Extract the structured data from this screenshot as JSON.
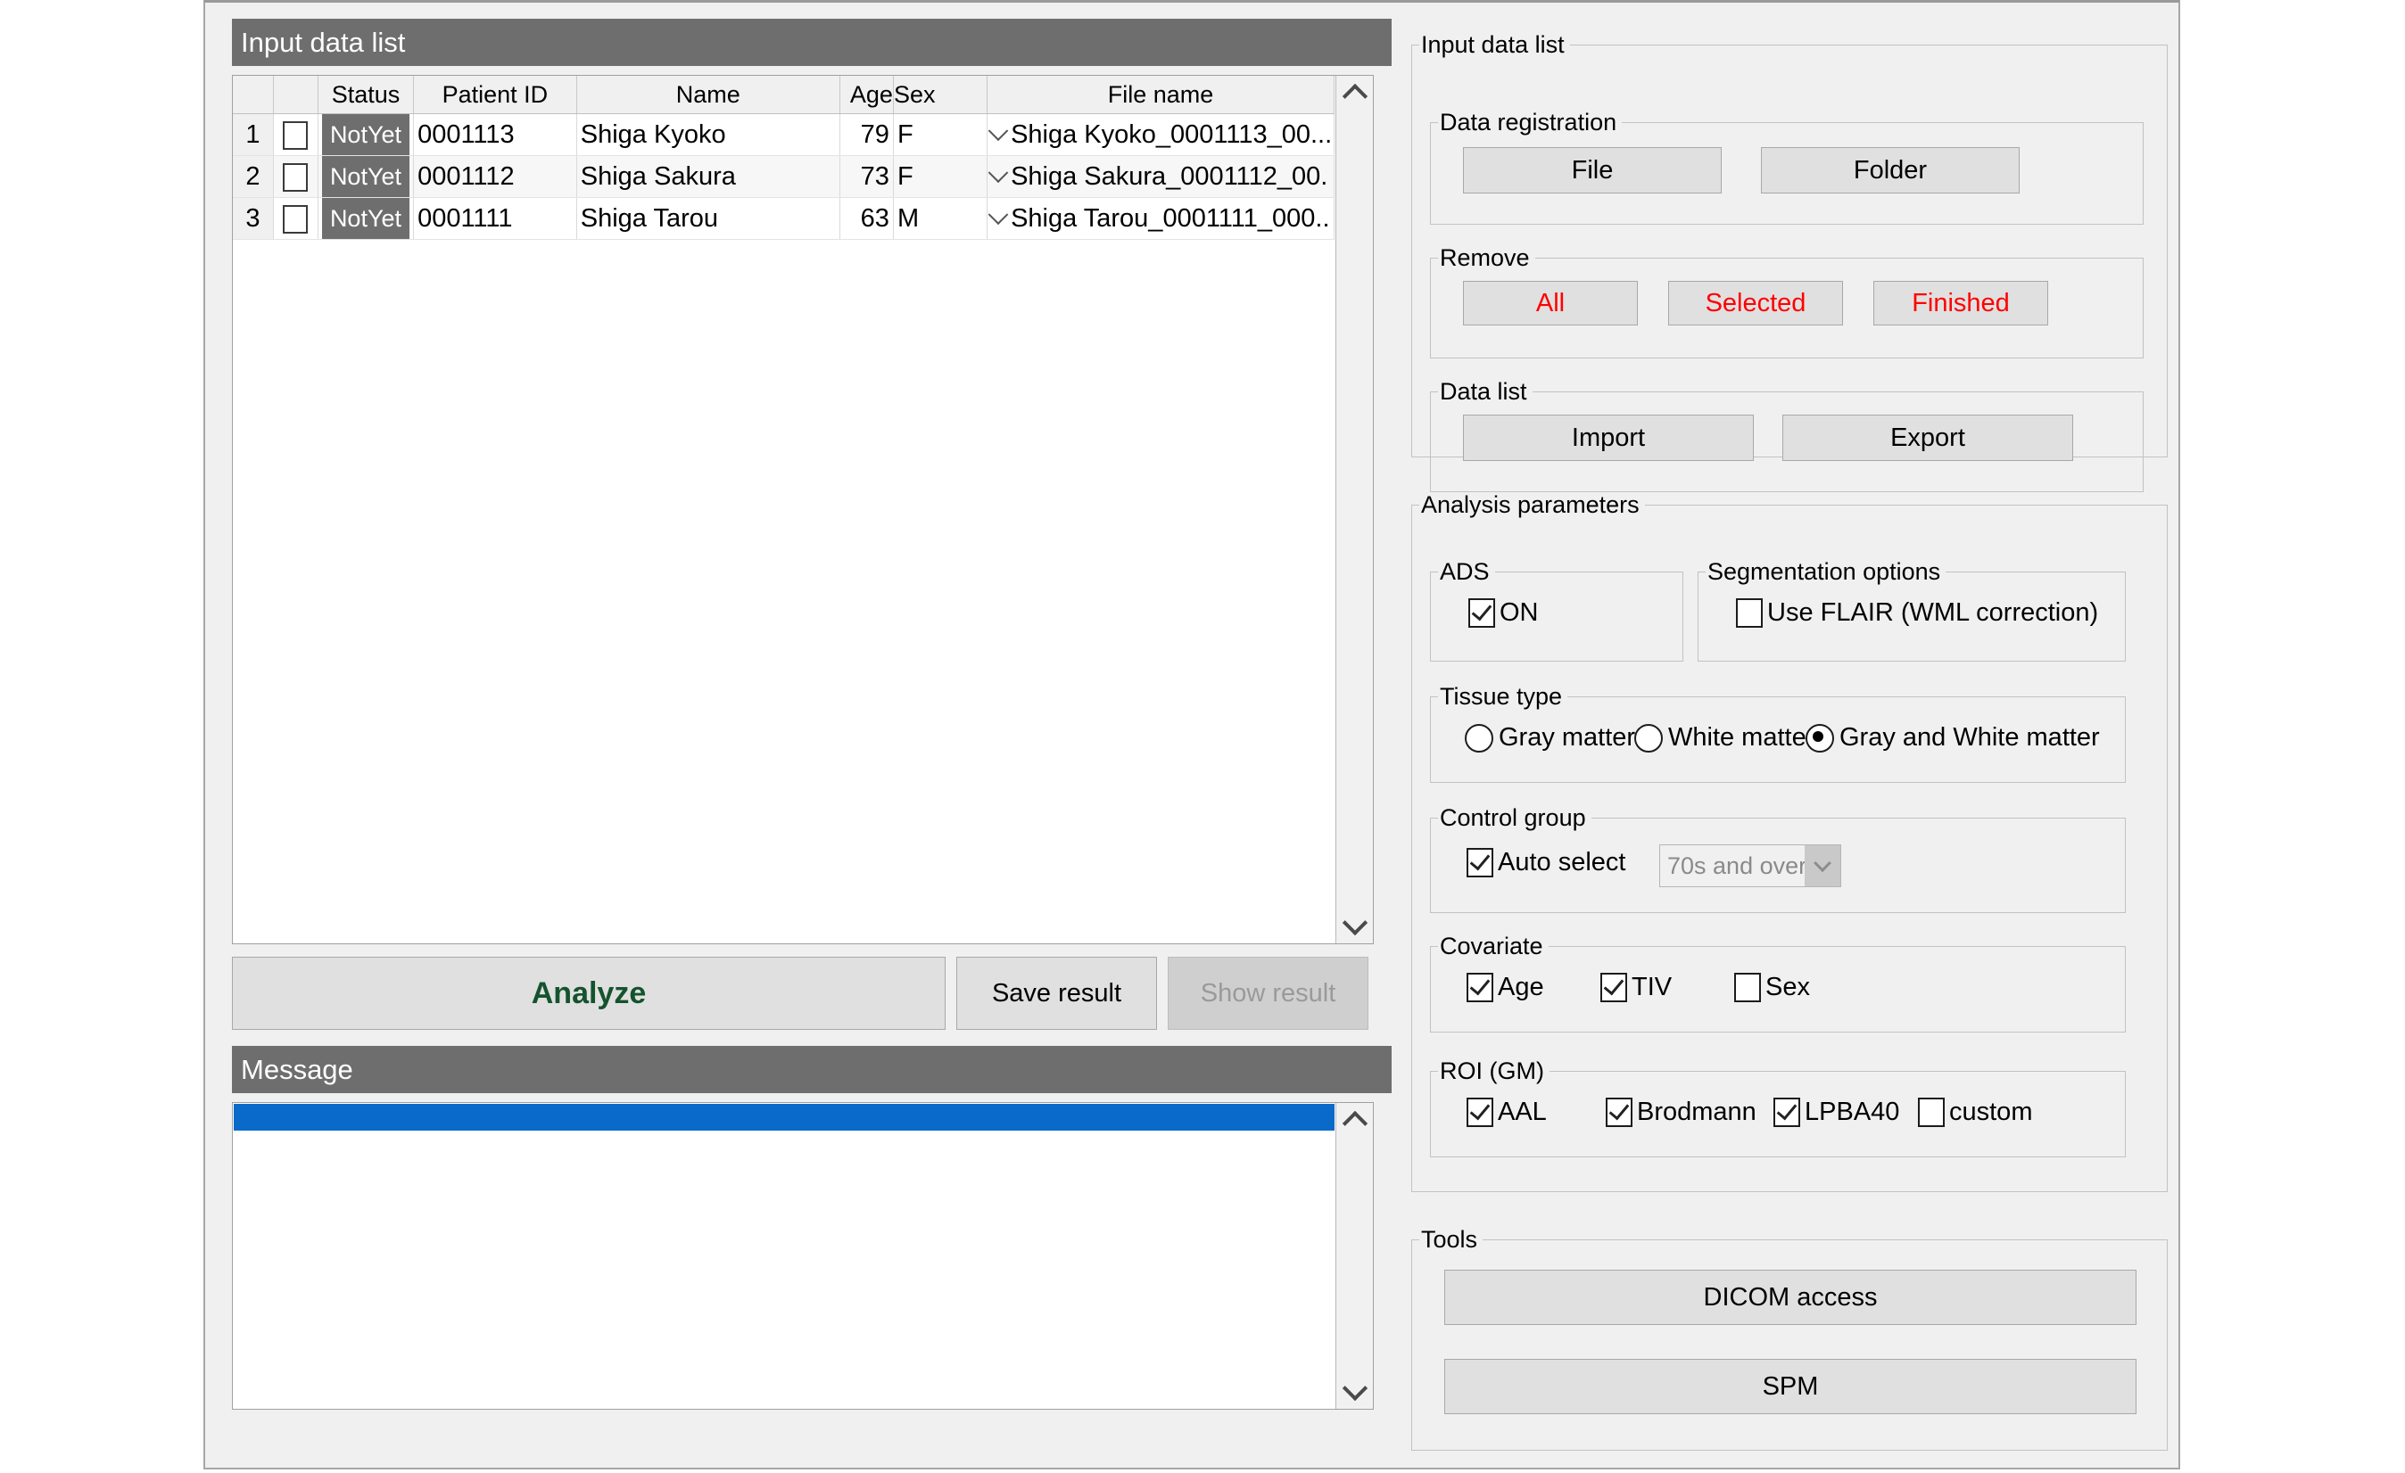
{
  "window": {
    "title": ""
  },
  "left": {
    "input_list_header": "Input data list",
    "table": {
      "columns": [
        "",
        "",
        "Status",
        "Patient ID",
        "Name",
        "Age",
        "Sex",
        "File name"
      ],
      "rows": [
        {
          "index": "1",
          "checked": false,
          "status": "NotYet",
          "patient_id": "0001113",
          "name": "Shiga Kyoko",
          "age": "79",
          "sex": "F",
          "file_name": "Shiga Kyoko_0001113_00..."
        },
        {
          "index": "2",
          "checked": false,
          "status": "NotYet",
          "patient_id": "0001112",
          "name": "Shiga Sakura",
          "age": "73",
          "sex": "F",
          "file_name": "Shiga Sakura_0001112_00..."
        },
        {
          "index": "3",
          "checked": false,
          "status": "NotYet",
          "patient_id": "0001111",
          "name": "Shiga Tarou",
          "age": "63",
          "sex": "M",
          "file_name": "Shiga Tarou_0001111_000..."
        }
      ]
    },
    "actions": {
      "analyze": "Analyze",
      "save_result": "Save result",
      "show_result": "Show result"
    },
    "message_header": "Message",
    "message_lines": []
  },
  "right": {
    "input_data_list": {
      "legend": "Input data list",
      "data_registration": {
        "legend": "Data registration",
        "file": "File",
        "folder": "Folder"
      },
      "remove": {
        "legend": "Remove",
        "all": "All",
        "selected": "Selected",
        "finished": "Finished"
      },
      "data_list": {
        "legend": "Data list",
        "import": "Import",
        "export": "Export"
      }
    },
    "analysis_parameters": {
      "legend": "Analysis parameters",
      "ads": {
        "legend": "ADS",
        "on_label": "ON",
        "on_checked": true
      },
      "segmentation_options": {
        "legend": "Segmentation options",
        "use_flair_label": "Use FLAIR (WML correction)",
        "use_flair_checked": false
      },
      "tissue_type": {
        "legend": "Tissue type",
        "options": [
          "Gray matter",
          "White matter",
          "Gray and White matter"
        ],
        "selected": "Gray and White matter"
      },
      "control_group": {
        "legend": "Control group",
        "auto_select_label": "Auto select",
        "auto_select_checked": true,
        "age_group_value": "70s and over"
      },
      "covariate": {
        "legend": "Covariate",
        "items": [
          {
            "label": "Age",
            "checked": true
          },
          {
            "label": "TIV",
            "checked": true
          },
          {
            "label": "Sex",
            "checked": false
          }
        ]
      },
      "roi_gm": {
        "legend": "ROI (GM)",
        "items": [
          {
            "label": "AAL",
            "checked": true
          },
          {
            "label": "Brodmann",
            "checked": true
          },
          {
            "label": "LPBA40",
            "checked": true
          },
          {
            "label": "custom",
            "checked": false
          }
        ]
      }
    },
    "tools": {
      "legend": "Tools",
      "dicom_access": "DICOM access",
      "spm": "SPM"
    }
  },
  "colors": {
    "section_bar": "#6e6e6e",
    "accent_blue": "#0a6ac9",
    "danger_red": "#ff0000",
    "analyze_green": "#14532d",
    "panel_bg": "#f0f0f0",
    "button_bg": "#e0e0e0",
    "status_chip_bg": "#6e6e6e"
  }
}
